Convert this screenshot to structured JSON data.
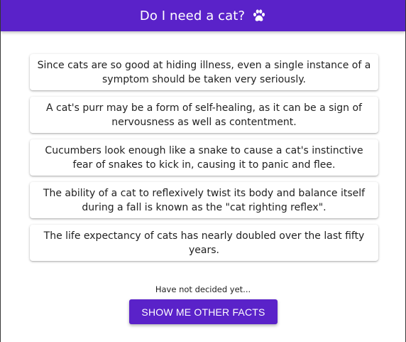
{
  "header": {
    "title": "Do I need a cat?",
    "icon": "paw-icon"
  },
  "facts": [
    "Since cats are so good at hiding illness, even a single instance of a symptom should be taken very seriously.",
    "A cat's purr may be a form of self-healing, as it can be a sign of nervousness as well as contentment.",
    "Cucumbers look enough like a snake to cause a cat's instinctive fear of snakes to kick in, causing it to panic and flee.",
    "The ability of a cat to reflexively twist its body and balance itself during a fall is known as the \"cat righting reflex\".",
    "The life expectancy of cats has nearly doubled over the last fifty years."
  ],
  "status": {
    "text": "Have not decided yet..."
  },
  "action": {
    "label": "SHOW ME OTHER FACTS"
  },
  "colors": {
    "primary": "#5a22c9",
    "on_primary": "#ffffff"
  }
}
